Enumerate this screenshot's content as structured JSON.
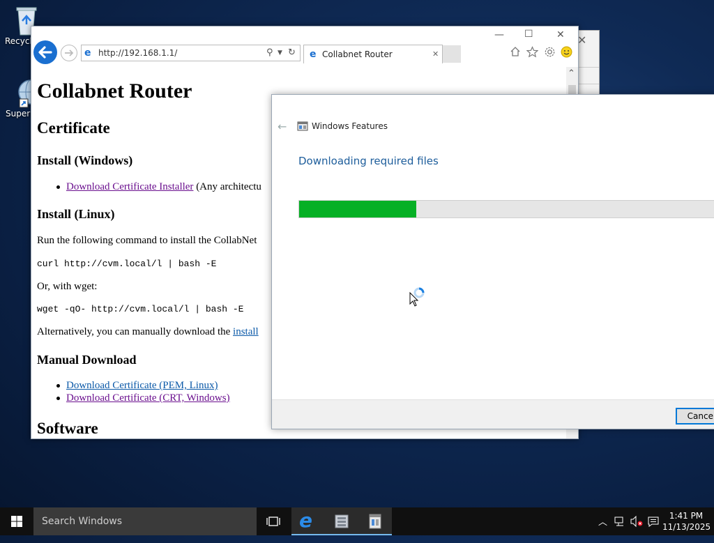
{
  "desktop": {
    "icons": [
      {
        "label": "Recycl",
        "icon": "recycle-bin-icon"
      },
      {
        "label": "Superm",
        "icon": "globe-shortcut-icon"
      }
    ]
  },
  "browser": {
    "address": "http://192.168.1.1/",
    "tab_title": "Collabnet Router"
  },
  "page": {
    "title": "Collabnet Router",
    "cert_heading": "Certificate",
    "win_heading": "Install (Windows)",
    "win_link": "Download Certificate Installer",
    "win_link_suffix": " (Any architectu",
    "linux_heading": "Install (Linux)",
    "linux_text": "Run the following command to install the CollabNet",
    "curl_cmd": "curl http://cvm.local/l | bash -E",
    "wget_text": "Or, with wget:",
    "wget_cmd": "wget -qO- http://cvm.local/l | bash -E",
    "alt_text": "Alternatively, you can manually download the ",
    "alt_link": "install",
    "manual_heading": "Manual Download",
    "manual_link_pem": "Download Certificate (PEM, Linux)",
    "manual_link_crt": "Download Certificate (CRT, Windows)",
    "software_heading": "Software"
  },
  "dialog": {
    "title": "Windows Features",
    "heading": "Downloading required files",
    "progress": 0.28,
    "cancel_label": "Cancel"
  },
  "taskbar": {
    "search_placeholder": "Search Windows",
    "time": "1:41 PM",
    "date": "11/13/2025"
  },
  "colors": {
    "progress_fill": "#06b025",
    "link_visited": "#6a0f8e",
    "link_unvisited": "#0b59a8",
    "dialog_heading": "#1d5d9b",
    "ie_blue": "#1a6fd0"
  }
}
